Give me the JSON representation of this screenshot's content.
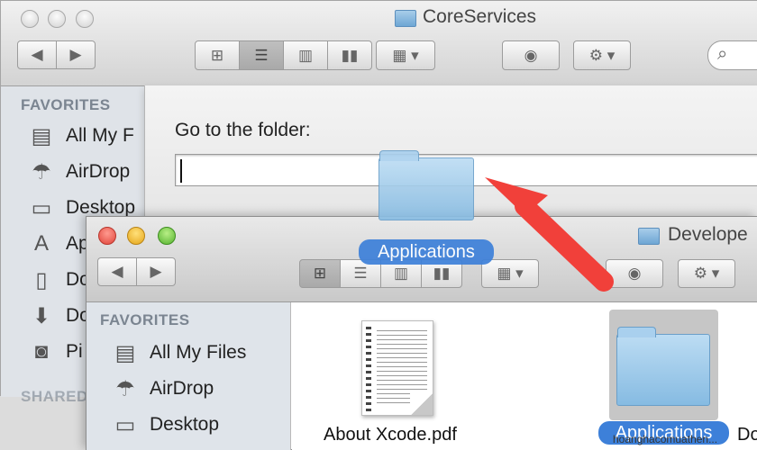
{
  "back_window": {
    "title": "CoreServices",
    "sidebar": {
      "heading": "FAVORITES",
      "items": [
        "All My F",
        "AirDrop",
        "Desktop",
        "Ap",
        "Do",
        "Do",
        "Pi"
      ],
      "partial_heading": "SHARED"
    }
  },
  "goto_sheet": {
    "label": "Go to the folder:",
    "input_value": ""
  },
  "front_window": {
    "title": "Develope",
    "sidebar": {
      "heading": "FAVORITES",
      "items": [
        "All My Files",
        "AirDrop",
        "Desktop"
      ]
    },
    "files": [
      {
        "name": "About Xcode.pdf",
        "kind": "pdf"
      },
      {
        "name": "Applications",
        "kind": "folder",
        "selected": true
      },
      {
        "name": "Do",
        "kind": "partial"
      }
    ]
  },
  "drag": {
    "label": "Applications"
  },
  "watermark": "hoanghacomuathen...",
  "icons": {
    "traffic_lights": "circle",
    "back": "chevron-left-icon",
    "forward": "chevron-right-icon",
    "views": [
      "icon-view-icon",
      "list-view-icon",
      "column-view-icon",
      "coverflow-view-icon"
    ],
    "arrange": "arrange-icon",
    "quicklook": "eye-icon",
    "action": "gear-icon",
    "search": "search-icon"
  },
  "colors": {
    "selection_blue": "#3d80d9",
    "arrow_red": "#f1403a",
    "folder_blue": "#86bbe2"
  }
}
